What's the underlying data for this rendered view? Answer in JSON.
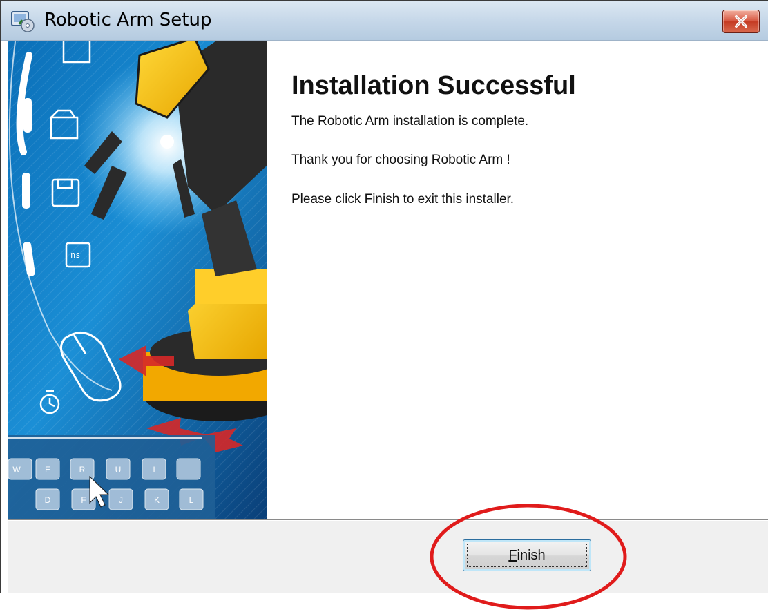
{
  "window": {
    "title": "Robotic Arm Setup"
  },
  "content": {
    "heading": "Installation Successful",
    "lines": [
      "The Robotic Arm installation is complete.",
      "Thank you for choosing Robotic Arm !",
      "Please click Finish to exit this installer."
    ]
  },
  "footer": {
    "finish_mnemonic": "F",
    "finish_rest": "inish"
  },
  "banner": {
    "keys_row1": [
      "W",
      "E",
      "R",
      "U",
      "I"
    ],
    "keys_row2": [
      "D",
      "F",
      "J",
      "K",
      "L"
    ],
    "disk_label": "ns"
  },
  "colors": {
    "accent": "#1a6fb5",
    "annotation": "#e01b1b"
  },
  "icons": {
    "app": "setup-disc-icon",
    "close": "close-x-icon"
  }
}
